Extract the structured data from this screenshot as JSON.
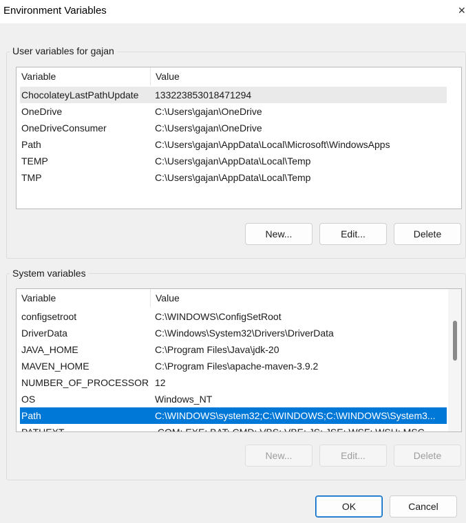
{
  "window": {
    "title": "Environment Variables",
    "close_glyph": "✕"
  },
  "user_group": {
    "label": "User variables for gajan",
    "columns": [
      "Variable",
      "Value"
    ],
    "rows": [
      {
        "variable": "ChocolateyLastPathUpdate",
        "value": "133223853018471294"
      },
      {
        "variable": "OneDrive",
        "value": "C:\\Users\\gajan\\OneDrive"
      },
      {
        "variable": "OneDriveConsumer",
        "value": "C:\\Users\\gajan\\OneDrive"
      },
      {
        "variable": "Path",
        "value": "C:\\Users\\gajan\\AppData\\Local\\Microsoft\\WindowsApps"
      },
      {
        "variable": "TEMP",
        "value": "C:\\Users\\gajan\\AppData\\Local\\Temp"
      },
      {
        "variable": "TMP",
        "value": "C:\\Users\\gajan\\AppData\\Local\\Temp"
      }
    ],
    "buttons": {
      "new": "New...",
      "edit": "Edit...",
      "delete": "Delete"
    }
  },
  "system_group": {
    "label": "System variables",
    "columns": [
      "Variable",
      "Value"
    ],
    "rows": [
      {
        "variable": "configsetroot",
        "value": "C:\\WINDOWS\\ConfigSetRoot"
      },
      {
        "variable": "DriverData",
        "value": "C:\\Windows\\System32\\Drivers\\DriverData"
      },
      {
        "variable": "JAVA_HOME",
        "value": "C:\\Program Files\\Java\\jdk-20"
      },
      {
        "variable": "MAVEN_HOME",
        "value": "C:\\Program Files\\apache-maven-3.9.2"
      },
      {
        "variable": "NUMBER_OF_PROCESSORS",
        "value": "12"
      },
      {
        "variable": "OS",
        "value": "Windows_NT"
      },
      {
        "variable": "Path",
        "value": "C:\\WINDOWS\\system32;C:\\WINDOWS;C:\\WINDOWS\\System3..."
      },
      {
        "variable": "PATHEXT",
        "value": ".COM;.EXE;.BAT;.CMD;.VBS;.VBE;.JS;.JSE;.WSF;.WSH;.MSC"
      }
    ],
    "selected_variable": "Path",
    "buttons": {
      "new": "New...",
      "edit": "Edit...",
      "delete": "Delete"
    }
  },
  "footer": {
    "ok": "OK",
    "cancel": "Cancel"
  },
  "colors": {
    "selection": "#0078d7",
    "hover": "#eaeaea",
    "ok_border": "#0067c0"
  }
}
